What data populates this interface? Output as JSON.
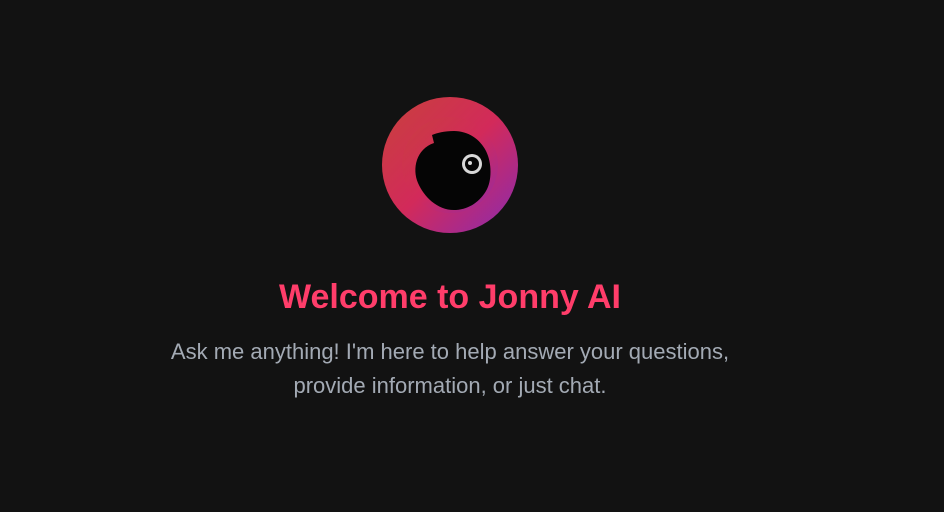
{
  "welcome": {
    "title": "Welcome to Jonny AI",
    "subtitle_line1": "Ask me anything! I'm here to help answer your questions,",
    "subtitle_line2": "provide information, or just chat."
  },
  "logo": {
    "icon": "jonny-ai-logo-icon",
    "gradient_start": "#c8413c",
    "gradient_mid": "#d22a5a",
    "gradient_end": "#8a2bb0"
  },
  "colors": {
    "background": "#121212",
    "title": "#ff3d6a",
    "subtitle": "#a3aab4"
  }
}
